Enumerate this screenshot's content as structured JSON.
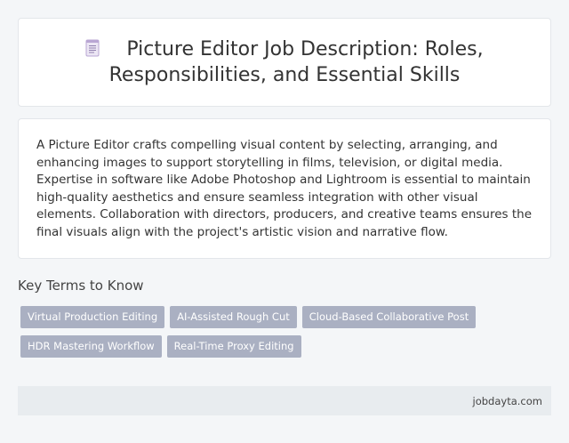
{
  "header": {
    "icon": "document-icon",
    "title": "Picture Editor Job Description: Roles, Responsibilities, and Essential Skills"
  },
  "description": {
    "text": "A Picture Editor crafts compelling visual content by selecting, arranging, and enhancing images to support storytelling in films, television, or digital media. Expertise in software like Adobe Photoshop and Lightroom is essential to maintain high-quality aesthetics and ensure seamless integration with other visual elements. Collaboration with directors, producers, and creative teams ensures the final visuals align with the project's artistic vision and narrative flow."
  },
  "key_terms": {
    "heading": "Key Terms to Know",
    "items": [
      {
        "label": "Virtual Production Editing"
      },
      {
        "label": "AI-Assisted Rough Cut"
      },
      {
        "label": "Cloud-Based Collaborative Post"
      },
      {
        "label": "HDR Mastering Workflow"
      },
      {
        "label": "Real-Time Proxy Editing"
      }
    ]
  },
  "footer": {
    "site": "jobdayta.com"
  },
  "colors": {
    "page_bg": "#f4f6f8",
    "card_bg": "#ffffff",
    "tag_bg": "#aab0c2",
    "footer_bg": "#e8ecef",
    "icon_accent": "#b9a6d3"
  }
}
